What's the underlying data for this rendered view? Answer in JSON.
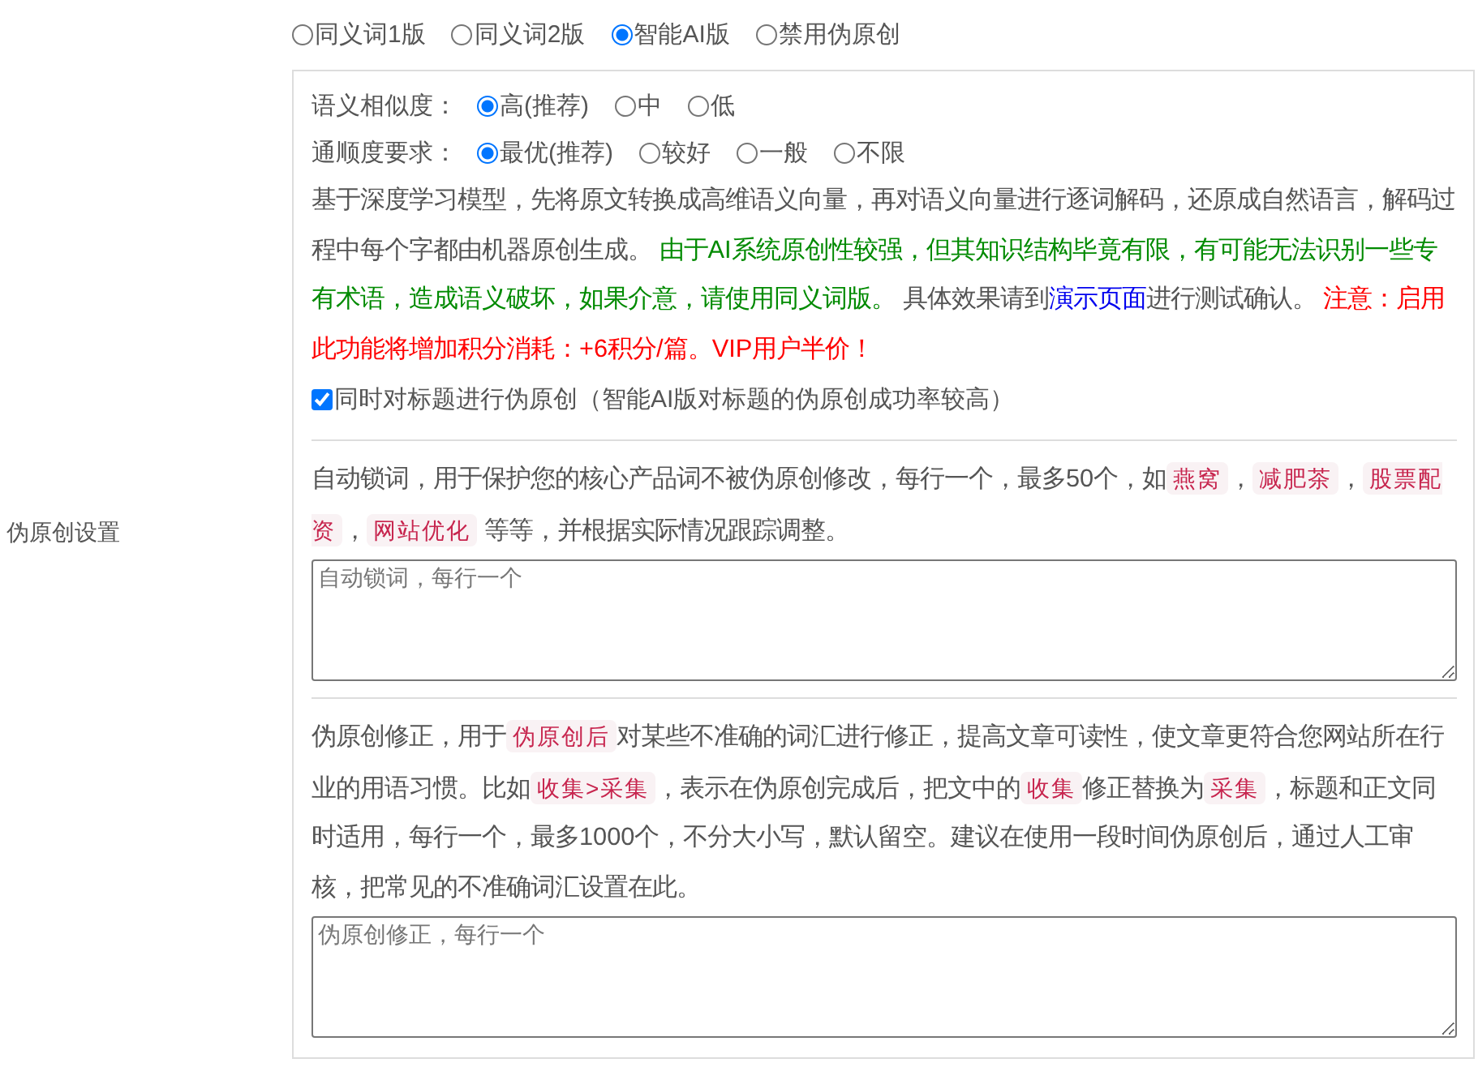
{
  "label": "伪原创设置",
  "modes": [
    {
      "label": "同义词1版",
      "selected": false
    },
    {
      "label": "同义词2版",
      "selected": false
    },
    {
      "label": "智能AI版",
      "selected": true
    },
    {
      "label": "禁用伪原创",
      "selected": false
    }
  ],
  "options": [
    {
      "label": "语义相似度：",
      "choices": [
        {
          "label": "高(推荐)",
          "selected": true
        },
        {
          "label": "中",
          "selected": false
        },
        {
          "label": "低",
          "selected": false
        }
      ]
    },
    {
      "label": "通顺度要求：",
      "choices": [
        {
          "label": "最优(推荐)",
          "selected": true
        },
        {
          "label": "较好",
          "selected": false
        },
        {
          "label": "一般",
          "selected": false
        },
        {
          "label": "不限",
          "selected": false
        }
      ]
    }
  ],
  "description": [
    {
      "kind": "text",
      "text": "基于深度学习模型，先将原文转换成高维语义向量，再对语义向量进行逐词解码，还原成自然语言，解码过程中每个字都由机器原创生成。 "
    },
    {
      "kind": "note",
      "text": "由于AI系统原创性较强，但其知识结构毕竟有限，有可能无法识别一些专有术语，造成语义破坏，如果介意，请使用同义词版。"
    },
    {
      "kind": "text",
      "text": " 具体效果请到"
    },
    {
      "kind": "link",
      "text": "演示页面"
    },
    {
      "kind": "text",
      "text": "进行测试确认。 "
    },
    {
      "kind": "warning",
      "text": "注意：启用此功能将增加积分消耗：+6积分/篇。VIP用户半价！"
    }
  ],
  "title_option": {
    "label": "同时对标题进行伪原创（智能AI版对标题的伪原创成功率较高）",
    "checked": true
  },
  "lock_words": {
    "description": [
      {
        "kind": "text",
        "text": "自动锁词，用于保护您的核心产品词不被伪原创修改，每行一个，最多50个，如"
      },
      {
        "kind": "tag",
        "text": "燕窝"
      },
      {
        "kind": "text",
        "text": "，"
      },
      {
        "kind": "tag",
        "text": "减肥茶"
      },
      {
        "kind": "text",
        "text": "，"
      },
      {
        "kind": "tag",
        "text": "股票配资"
      },
      {
        "kind": "text",
        "text": "，"
      },
      {
        "kind": "tag",
        "text": "网站优化"
      },
      {
        "kind": "text",
        "text": " 等等，并根据实际情况跟踪调整。"
      }
    ],
    "placeholder": "自动锁词，每行一个"
  },
  "corrections": {
    "description": [
      {
        "kind": "text",
        "text": "伪原创修正，用于"
      },
      {
        "kind": "tag",
        "text": "伪原创后"
      },
      {
        "kind": "text",
        "text": "对某些不准确的词汇进行修正，提高文章可读性，使文章更符合您网站所在行业的用语习惯。比如"
      },
      {
        "kind": "tag",
        "text": "收集>采集"
      },
      {
        "kind": "text",
        "text": "，表示在伪原创完成后，把文中的"
      },
      {
        "kind": "tag",
        "text": "收集"
      },
      {
        "kind": "text",
        "text": "修正替换为"
      },
      {
        "kind": "tag",
        "text": "采集"
      },
      {
        "kind": "text",
        "text": "，标题和正文同时适用，每行一个，最多1000个，不分大小写，默认留空。建议在使用一段时间伪原创后，通过人工审核，把常见的不准确词汇设置在此。"
      }
    ],
    "placeholder": "伪原创修正，每行一个"
  }
}
